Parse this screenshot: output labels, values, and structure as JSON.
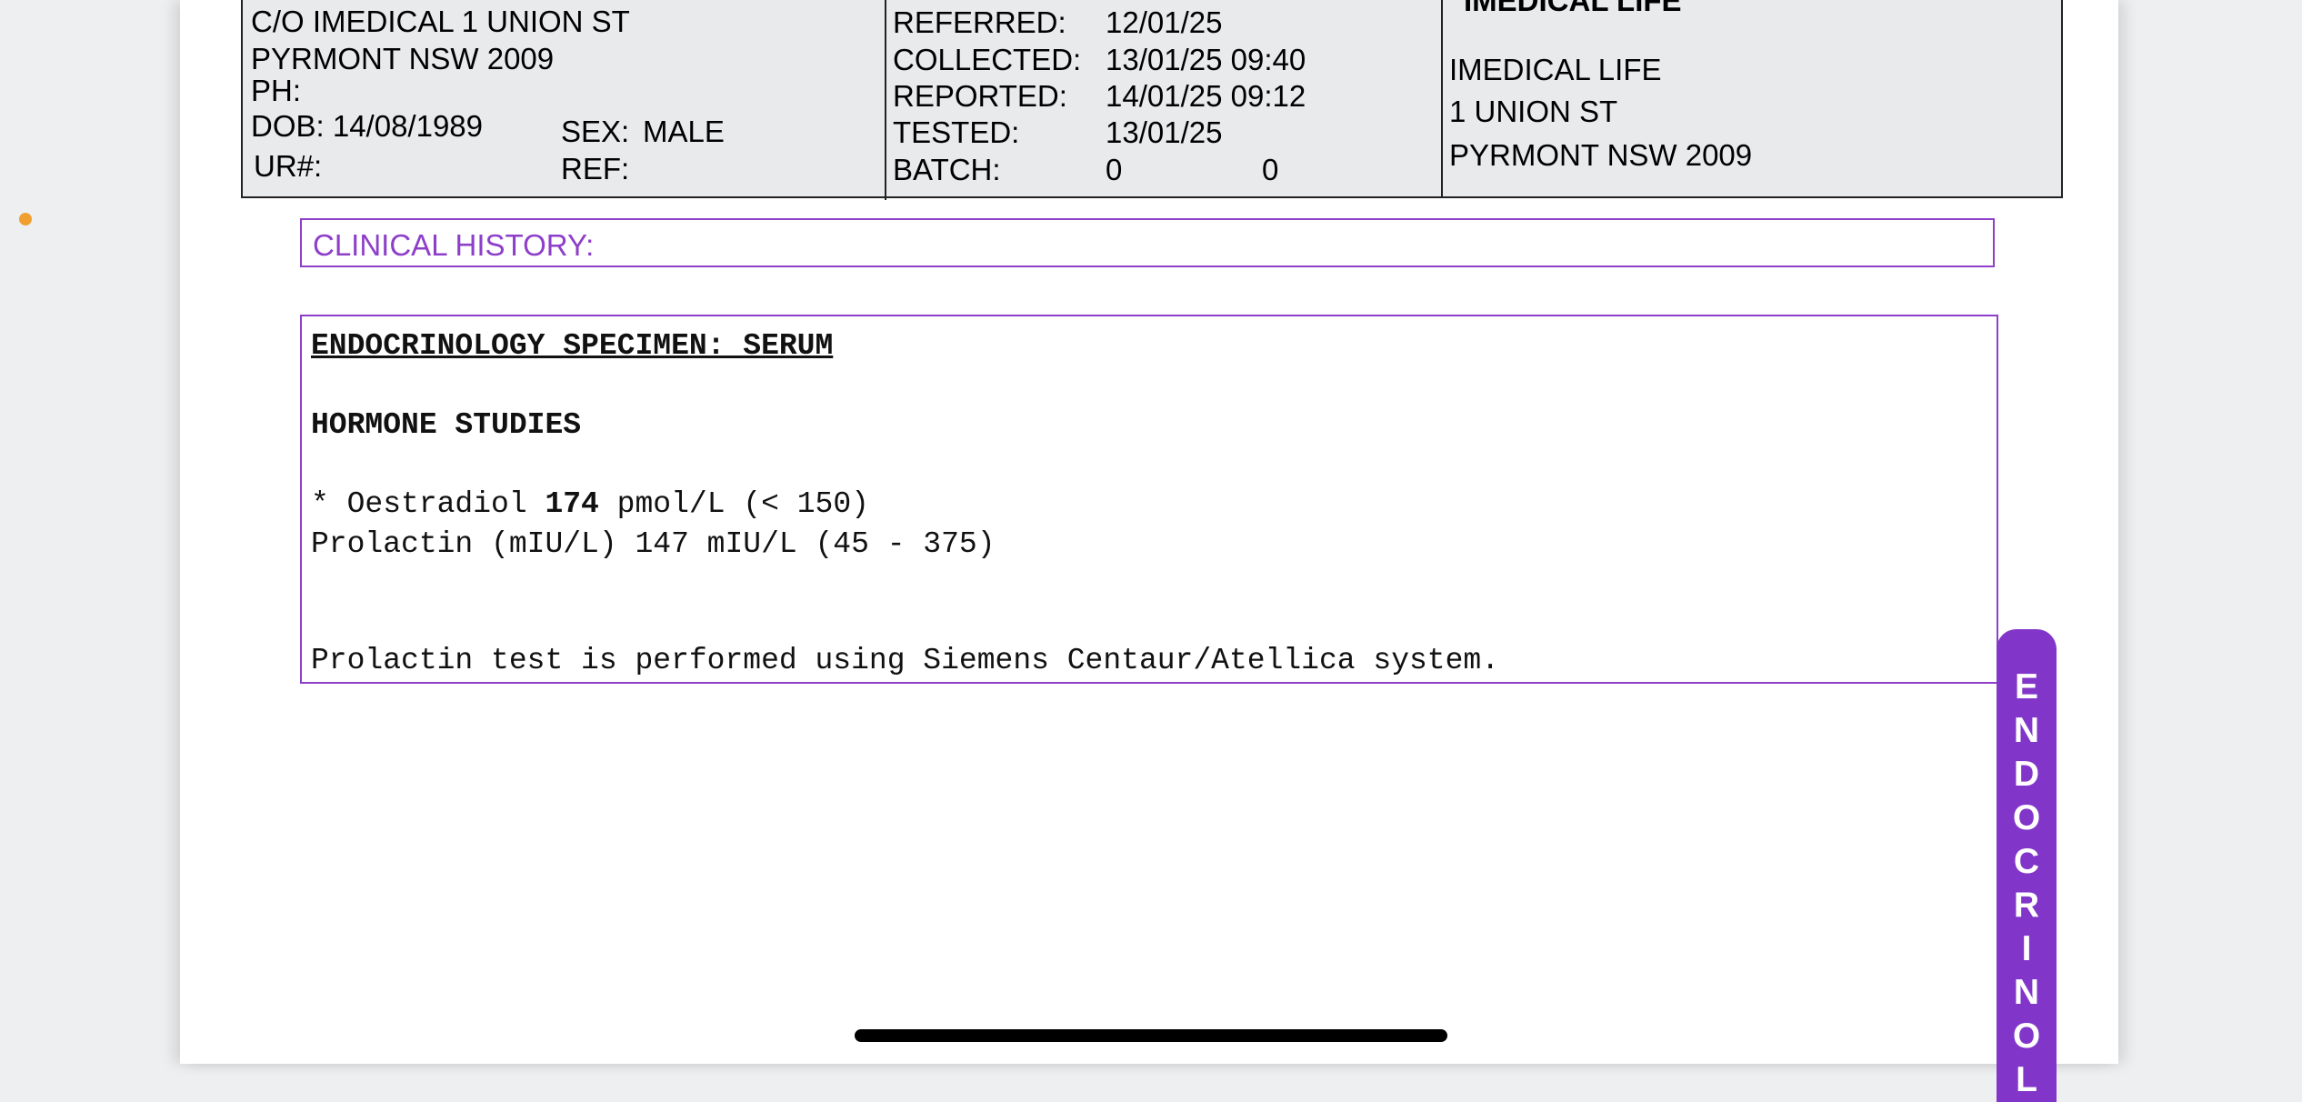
{
  "header": {
    "patient": {
      "address_line1": "C/O IMEDICAL 1 UNION ST",
      "address_line2": "PYRMONT NSW 2009",
      "phone_label": "PH:",
      "dob": "DOB: 14/08/1989",
      "sex_label": "SEX:",
      "sex_value": "MALE",
      "ur_label": "UR#:",
      "ref_label": "REF:"
    },
    "dates": {
      "referred_label": "REFERRED:",
      "referred_value": "12/01/25",
      "collected_label": "COLLECTED:",
      "collected_value": "13/01/25 09:40",
      "reported_label": "REPORTED:",
      "reported_value": "14/01/25 09:12",
      "tested_label": "TESTED:",
      "tested_value": "13/01/25",
      "batch_label": "BATCH:",
      "batch_value1": "0",
      "batch_value2": "0"
    },
    "doctor": {
      "heading": "IMEDICAL LIFE",
      "name": "IMEDICAL LIFE",
      "address_line1": "1 UNION ST",
      "address_line2": "PYRMONT NSW 2009"
    }
  },
  "clinical_history": {
    "label": "CLINICAL HISTORY:"
  },
  "report": {
    "specimen_title": "ENDOCRINOLOGY SPECIMEN: SERUM",
    "section_title": "HORMONE STUDIES",
    "oestradiol_prefix": "* Oestradiol ",
    "oestradiol_value": "174",
    "oestradiol_suffix": " pmol/L (< 150)",
    "prolactin_line": "Prolactin (mIU/L) 147 mIU/L (45 - 375)",
    "footnote": "Prolactin test is performed using Siemens Centaur/Atellica system."
  },
  "side_tab": {
    "letters": [
      "E",
      "N",
      "D",
      "O",
      "C",
      "R",
      "I",
      "N",
      "O",
      "L"
    ]
  }
}
